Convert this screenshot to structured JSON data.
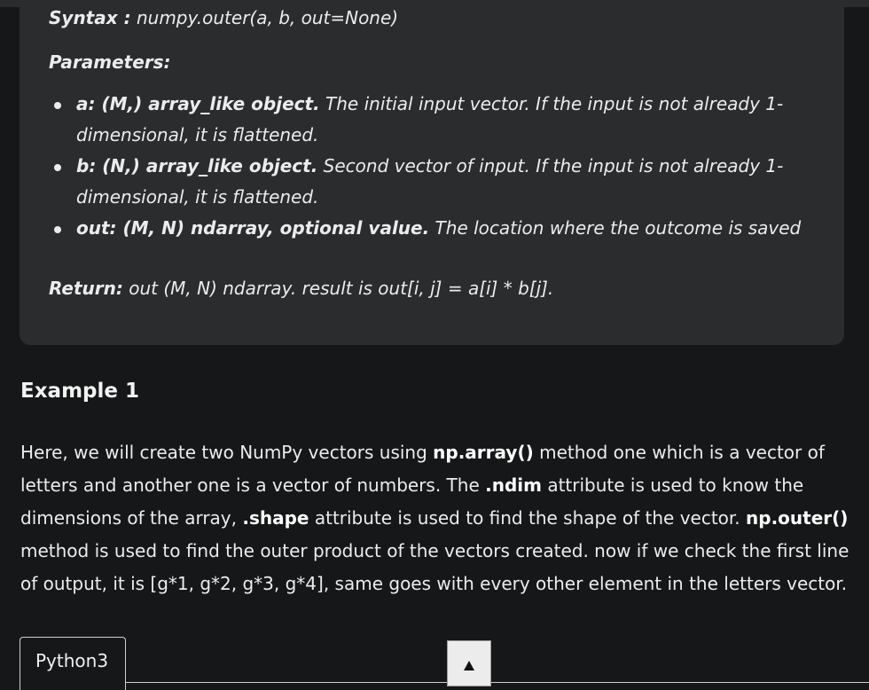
{
  "syntax": {
    "label": "Syntax :",
    "signature": " numpy.outer(a, b, out=None)"
  },
  "parameters": {
    "heading": "Parameters:",
    "items": [
      {
        "term": "a: (M,) array_like object.",
        "desc": " The initial input vector. If the input is not already 1-dimensional, it is flattened."
      },
      {
        "term": "b: (N,) array_like object.",
        "desc": " Second vector of input. If the input is not already 1-dimensional, it is flattened."
      },
      {
        "term": "out: (M, N) ndarray, optional value.",
        "desc": " The location where the outcome is saved"
      }
    ]
  },
  "return": {
    "label": "Return:",
    "text": " out (M, N) ndarray. result is out[i, j] = a[i] * b[j]."
  },
  "example": {
    "heading": "Example 1",
    "segments": [
      "Here, we will create two NumPy vectors using ",
      "np.array()",
      " method one which is a vector of letters and another one is a vector of numbers. The ",
      ".ndim",
      " attribute is used to know the dimensions of the array, ",
      ".shape",
      " attribute is used to find the shape of the vector. ",
      "np.outer()",
      " method is used to find the outer product of the vectors created. now if we check the first line of output, it is [g*1, g*2, g*3, g*4], same goes with every other element in the letters vector."
    ]
  },
  "code_tabs": {
    "active_tab": "Python3"
  },
  "icons": {
    "scroll_up": "triangle-up-icon"
  }
}
